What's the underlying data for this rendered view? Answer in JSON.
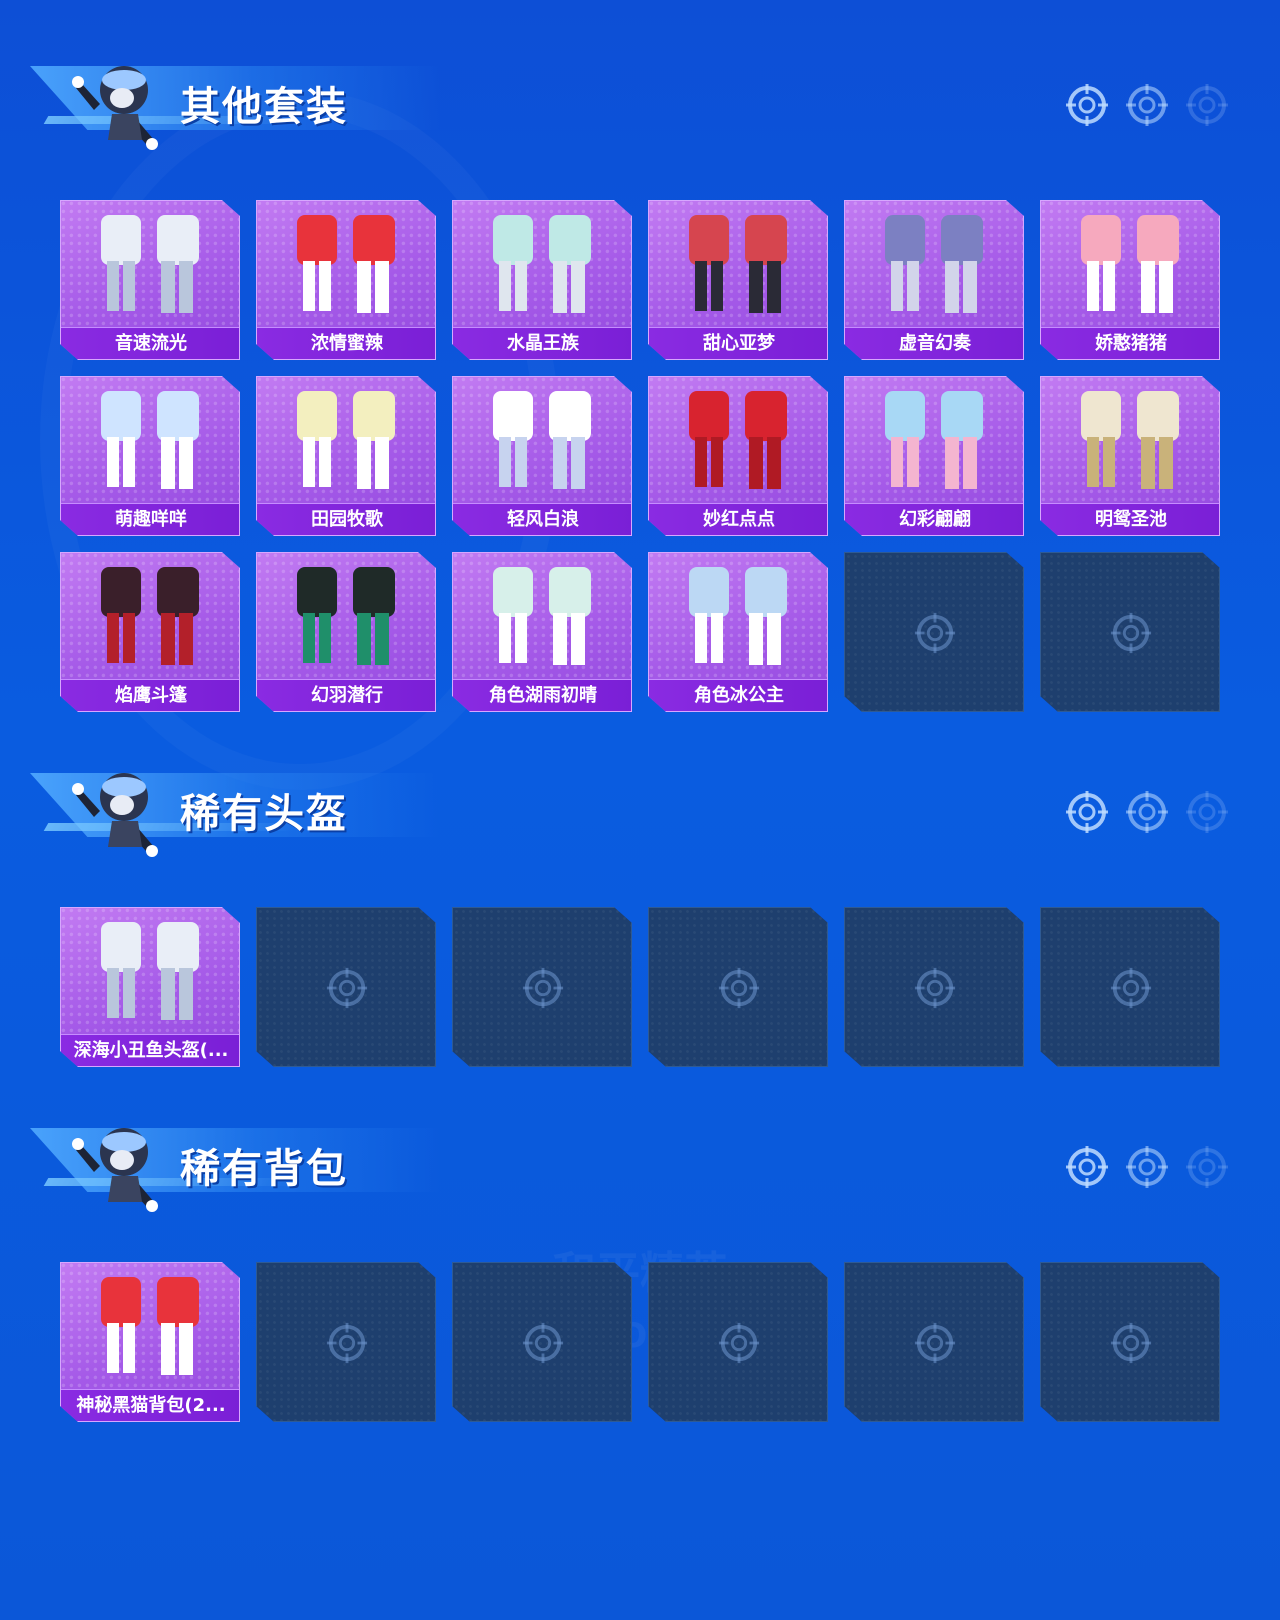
{
  "colors": {
    "background": "#0b57d8",
    "card_purple": "#a55ae8",
    "label_purple": "#8a2be2",
    "empty_slot": "#1e3f6e"
  },
  "watermark": {
    "line1": "和平精英",
    "line2": "GAME FOR PEACE"
  },
  "sections": [
    {
      "title": "其他套装",
      "icon": "mascot-icon",
      "rows": [
        [
          "音速流光",
          "浓情蜜辣",
          "水晶王族",
          "甜心亚梦",
          "虚音幻奏",
          "娇憨猪猪"
        ],
        [
          "萌趣咩咩",
          "田园牧歌",
          "轻风白浪",
          "妙红点点",
          "幻彩翩翩",
          "明鸳圣池"
        ],
        [
          "焰鹰斗篷",
          "幻羽潜行",
          "角色湖雨初晴",
          "角色冰公主",
          null,
          null
        ]
      ]
    },
    {
      "title": "稀有头盔",
      "icon": "mascot-icon",
      "rows": [
        [
          "深海小丑鱼头盔(...",
          null,
          null,
          null,
          null,
          null
        ]
      ]
    },
    {
      "title": "稀有背包",
      "icon": "mascot-icon",
      "rows": [
        [
          "神秘黑猫背包(2...",
          null,
          null,
          null,
          null,
          null
        ]
      ]
    }
  ]
}
